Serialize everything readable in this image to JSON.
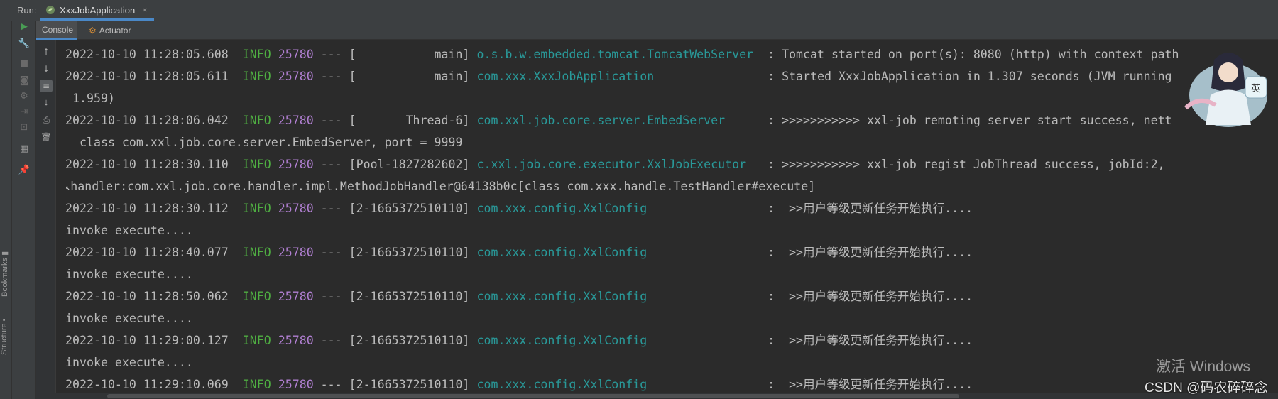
{
  "topbar": {
    "run_label": "Run:",
    "tab_label": "XxxJobApplication",
    "tab_close": "×"
  },
  "tabs": [
    {
      "label": "Console",
      "icon": "console-icon"
    },
    {
      "label": "Actuator",
      "icon": "actuator-icon"
    }
  ],
  "side_labels": {
    "bookmarks": "Bookmarks",
    "structure": "Structure"
  },
  "console": {
    "lines": [
      {
        "ts": "2022-10-10 11:28:05.608",
        "level": "INFO",
        "pid": "25780",
        "sep": " --- ",
        "thread": "[           main]",
        "logger": "o.s.b.w.embedded.tomcat.TomcatWebServer ",
        "msg": " : Tomcat started on port(s): 8080 (http) with context path"
      },
      {
        "ts": "2022-10-10 11:28:05.611",
        "level": "INFO",
        "pid": "25780",
        "sep": " --- ",
        "thread": "[           main]",
        "logger": "com.xxx.XxxJobApplication               ",
        "msg": " : Started XxxJobApplication in 1.307 seconds (JVM running"
      },
      {
        "plain": " 1.959)"
      },
      {
        "ts": "2022-10-10 11:28:06.042",
        "level": "INFO",
        "pid": "25780",
        "sep": " --- ",
        "thread": "[       Thread-6]",
        "logger": "com.xxl.job.core.server.EmbedServer     ",
        "msg": " : >>>>>>>>>>> xxl-job remoting server start success, nett"
      },
      {
        "plain": "  class com.xxl.job.core.server.EmbedServer, port = 9999"
      },
      {
        "ts": "2022-10-10 11:28:30.110",
        "level": "INFO",
        "pid": "25780",
        "sep": " --- ",
        "thread": "[Pool-1827282602]",
        "logger": "c.xxl.job.core.executor.XxlJobExecutor  ",
        "msg": " : >>>>>>>>>>> xxl-job regist JobThread success, jobId:2,"
      },
      {
        "plain": "handler:com.xxl.job.core.handler.impl.MethodJobHandler@64138b0c[class com.xxx.handle.TestHandler#execute]",
        "caret": true
      },
      {
        "ts": "2022-10-10 11:28:30.112",
        "level": "INFO",
        "pid": "25780",
        "sep": " --- ",
        "thread": "[2-1665372510110]",
        "logger": "com.xxx.config.XxlConfig                ",
        "msg": " :  >>用户等级更新任务开始执行...."
      },
      {
        "plain": "invoke execute...."
      },
      {
        "ts": "2022-10-10 11:28:40.077",
        "level": "INFO",
        "pid": "25780",
        "sep": " --- ",
        "thread": "[2-1665372510110]",
        "logger": "com.xxx.config.XxlConfig                ",
        "msg": " :  >>用户等级更新任务开始执行...."
      },
      {
        "plain": "invoke execute...."
      },
      {
        "ts": "2022-10-10 11:28:50.062",
        "level": "INFO",
        "pid": "25780",
        "sep": " --- ",
        "thread": "[2-1665372510110]",
        "logger": "com.xxx.config.XxlConfig                ",
        "msg": " :  >>用户等级更新任务开始执行...."
      },
      {
        "plain": "invoke execute...."
      },
      {
        "ts": "2022-10-10 11:29:00.127",
        "level": "INFO",
        "pid": "25780",
        "sep": " --- ",
        "thread": "[2-1665372510110]",
        "logger": "com.xxx.config.XxlConfig                ",
        "msg": " :  >>用户等级更新任务开始执行...."
      },
      {
        "plain": "invoke execute...."
      },
      {
        "ts": "2022-10-10 11:29:10.069",
        "level": "INFO",
        "pid": "25780",
        "sep": " --- ",
        "thread": "[2-1665372510110]",
        "logger": "com.xxx.config.XxlConfig                ",
        "msg": " :  >>用户等级更新任务开始执行...."
      }
    ]
  },
  "overlay": {
    "avatar_badge": "英",
    "watermark": "激活 Windows",
    "csdn": "CSDN @码农碎碎念"
  },
  "colors": {
    "level": "#4fae42",
    "pid": "#b07fd1",
    "logger": "#299999",
    "accent": "#4a88c7"
  }
}
